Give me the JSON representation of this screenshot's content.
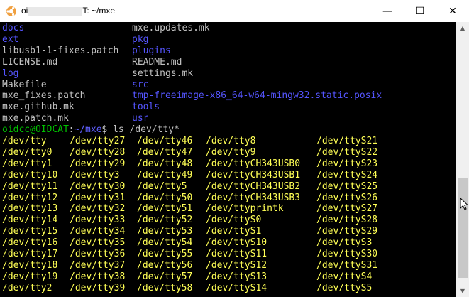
{
  "window": {
    "title_prefix": "oi",
    "title_suffix": "T: ~/mxe",
    "minimize_label": "—",
    "maximize_label": "☐",
    "close_label": "✕"
  },
  "colors": {
    "background": "#000000",
    "text": "#c0c0c0",
    "dir_blue": "#5555ff",
    "yellow": "#ffff55",
    "green": "#00c000",
    "blue_prompt": "#5f5fff"
  },
  "listing": [
    {
      "left": {
        "text": "docs",
        "kind": "dir"
      },
      "right": {
        "text": "mxe.updates.mk",
        "kind": "file"
      }
    },
    {
      "left": {
        "text": "ext",
        "kind": "dir"
      },
      "right": {
        "text": "pkg",
        "kind": "dir"
      }
    },
    {
      "left": {
        "text": "libusb1-1-fixes.patch",
        "kind": "file"
      },
      "right": {
        "text": "plugins",
        "kind": "dir"
      }
    },
    {
      "left": {
        "text": "LICENSE.md",
        "kind": "file"
      },
      "right": {
        "text": "README.md",
        "kind": "file"
      }
    },
    {
      "left": {
        "text": "log",
        "kind": "dir"
      },
      "right": {
        "text": "settings.mk",
        "kind": "file"
      }
    },
    {
      "left": {
        "text": "Makefile",
        "kind": "file"
      },
      "right": {
        "text": "src",
        "kind": "dir"
      }
    },
    {
      "left": {
        "text": "mxe_fixes.patch",
        "kind": "file"
      },
      "right": {
        "text": "tmp-freeimage-x86_64-w64-mingw32.static.posix",
        "kind": "dir"
      }
    },
    {
      "left": {
        "text": "mxe.github.mk",
        "kind": "file"
      },
      "right": {
        "text": "tools",
        "kind": "dir"
      }
    },
    {
      "left": {
        "text": "mxe.patch.mk",
        "kind": "file"
      },
      "right": {
        "text": "usr",
        "kind": "dir"
      }
    }
  ],
  "prompt": {
    "user_host": "oidcc@OIDCAT",
    "path": "~/mxe",
    "symbol": "$",
    "command": " ls /dev/tty*"
  },
  "tty_rows": [
    [
      "/dev/tty",
      "/dev/tty27",
      "/dev/tty46",
      "/dev/tty8",
      "/dev/ttyS21"
    ],
    [
      "/dev/tty0",
      "/dev/tty28",
      "/dev/tty47",
      "/dev/tty9",
      "/dev/ttyS22"
    ],
    [
      "/dev/tty1",
      "/dev/tty29",
      "/dev/tty48",
      "/dev/ttyCH343USB0",
      "/dev/ttyS23"
    ],
    [
      "/dev/tty10",
      "/dev/tty3",
      "/dev/tty49",
      "/dev/ttyCH343USB1",
      "/dev/ttyS24"
    ],
    [
      "/dev/tty11",
      "/dev/tty30",
      "/dev/tty5",
      "/dev/ttyCH343USB2",
      "/dev/ttyS25"
    ],
    [
      "/dev/tty12",
      "/dev/tty31",
      "/dev/tty50",
      "/dev/ttyCH343USB3",
      "/dev/ttyS26"
    ],
    [
      "/dev/tty13",
      "/dev/tty32",
      "/dev/tty51",
      "/dev/ttyprintk",
      "/dev/ttyS27"
    ],
    [
      "/dev/tty14",
      "/dev/tty33",
      "/dev/tty52",
      "/dev/ttyS0",
      "/dev/ttyS28"
    ],
    [
      "/dev/tty15",
      "/dev/tty34",
      "/dev/tty53",
      "/dev/ttyS1",
      "/dev/ttyS29"
    ],
    [
      "/dev/tty16",
      "/dev/tty35",
      "/dev/tty54",
      "/dev/ttyS10",
      "/dev/ttyS3"
    ],
    [
      "/dev/tty17",
      "/dev/tty36",
      "/dev/tty55",
      "/dev/ttyS11",
      "/dev/ttyS30"
    ],
    [
      "/dev/tty18",
      "/dev/tty37",
      "/dev/tty56",
      "/dev/ttyS12",
      "/dev/ttyS31"
    ],
    [
      "/dev/tty19",
      "/dev/tty38",
      "/dev/tty57",
      "/dev/ttyS13",
      "/dev/ttyS4"
    ],
    [
      "/dev/tty2",
      "/dev/tty39",
      "/dev/tty58",
      "/dev/ttyS14",
      "/dev/ttyS5"
    ]
  ]
}
